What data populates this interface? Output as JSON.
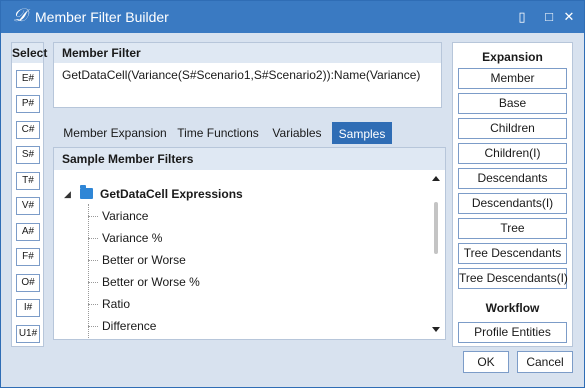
{
  "window": {
    "title": "Member Filter Builder",
    "logo_glyph": "𝒟",
    "controls": {
      "restore": "▯",
      "maximize": "□",
      "close": "✕"
    }
  },
  "select": {
    "header": "Select",
    "buttons": [
      "E#",
      "P#",
      "C#",
      "S#",
      "T#",
      "V#",
      "A#",
      "F#",
      "O#",
      "I#",
      "U1#"
    ]
  },
  "member_filter": {
    "header": "Member Filter",
    "value": "GetDataCell(Variance(S#Scenario1,S#Scenario2)):Name(Variance)"
  },
  "tabs": [
    {
      "label": "Member Expansion",
      "active": false
    },
    {
      "label": "Time Functions",
      "active": false
    },
    {
      "label": "Variables",
      "active": false
    },
    {
      "label": "Samples",
      "active": true
    }
  ],
  "samples": {
    "header": "Sample Member Filters",
    "parent": {
      "label": "GetDataCell Expressions",
      "expander": "◢",
      "icon": "folder-icon"
    },
    "items": [
      "Variance",
      "Variance %",
      "Better or Worse",
      "Better or Worse %",
      "Ratio",
      "Difference"
    ]
  },
  "expansion": {
    "header": "Expansion",
    "buttons": [
      "Member",
      "Base",
      "Children",
      "Children(I)",
      "Descendants",
      "Descendants(I)",
      "Tree",
      "Tree Descendants",
      "Tree Descendants(I)"
    ]
  },
  "workflow": {
    "header": "Workflow",
    "buttons": [
      "Profile Entities"
    ]
  },
  "footer": {
    "ok": "OK",
    "cancel": "Cancel"
  },
  "colors": {
    "accent": "#3a7ac2",
    "active_tab": "#2f6db5",
    "panel_bg": "#d8e2ef",
    "header_bg": "#dfe8f3",
    "folder": "#2f86d6"
  }
}
